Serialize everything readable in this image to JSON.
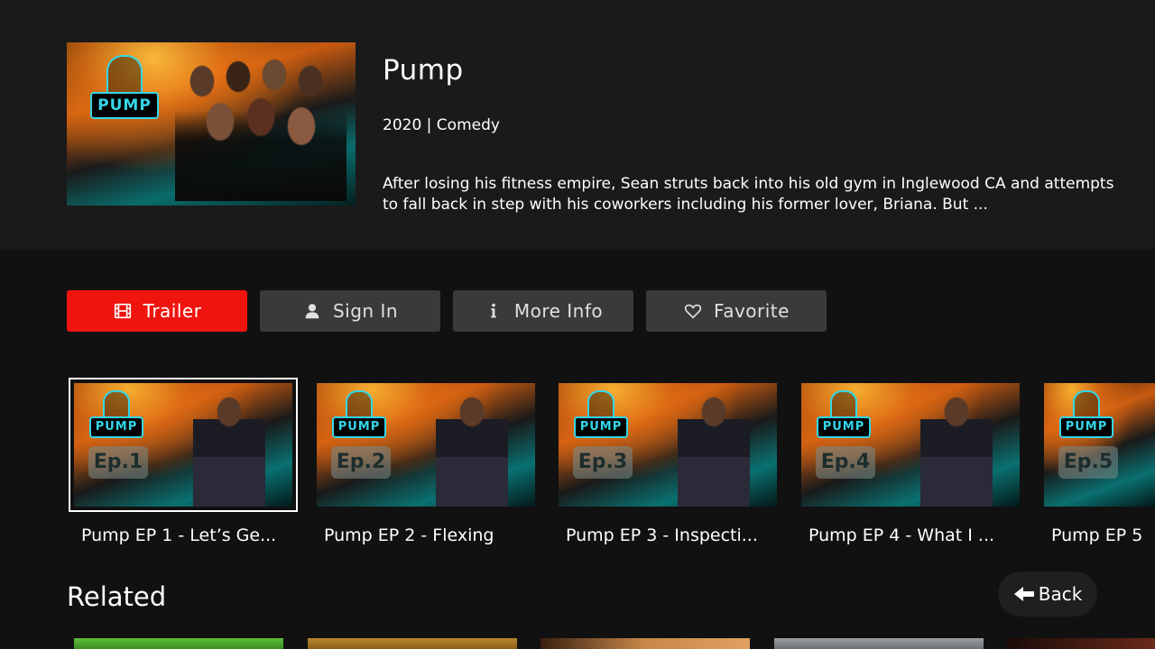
{
  "show": {
    "title": "Pump",
    "meta": "2020 | Comedy",
    "description": "After losing his fitness empire, Sean struts back into his old gym in Inglewood CA and attempts to fall back in step with his coworkers including his former lover, Briana. But ...",
    "poster_logo": "PUMP"
  },
  "actions": {
    "trailer": "Trailer",
    "sign_in": "Sign In",
    "more_info": "More Info",
    "favorite": "Favorite"
  },
  "episodes": [
    {
      "badge": "Ep.1",
      "logo": "PUMP",
      "label": "Pump EP 1 - Let’s Ge..."
    },
    {
      "badge": "Ep.2",
      "logo": "PUMP",
      "label": "Pump EP 2 - Flexing"
    },
    {
      "badge": "Ep.3",
      "logo": "PUMP",
      "label": "Pump EP 3 - Inspecti..."
    },
    {
      "badge": "Ep.4",
      "logo": "PUMP",
      "label": "Pump EP 4 - What I ..."
    },
    {
      "badge": "Ep.5",
      "logo": "PUMP",
      "label": "Pump EP 5"
    }
  ],
  "related": {
    "heading": "Related"
  },
  "back": {
    "label": "Back"
  },
  "colors": {
    "primary": "#f0140f",
    "button": "#3a3a3a",
    "background": "#111111",
    "hero_background": "#1a1a1a",
    "logo_accent": "#33d6e8"
  },
  "icons": {
    "trailer": "film-icon",
    "sign_in": "user-icon",
    "more_info": "info-icon",
    "favorite": "heart-icon",
    "back": "arrow-left-icon"
  }
}
